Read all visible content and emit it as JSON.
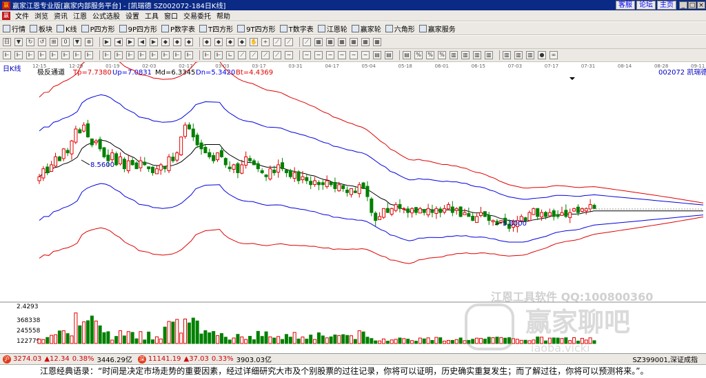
{
  "window": {
    "title": "赢家江恩专业版[赢家内部服务平台] - [凯瑞德  SZ002072-184日K线]",
    "top_links": [
      "客服",
      "论坛",
      "主页"
    ],
    "controls": [
      "_",
      "□",
      "×"
    ]
  },
  "menu": [
    "文件",
    "浏览",
    "资讯",
    "江恩",
    "公式选股",
    "设置",
    "工具",
    "窗口",
    "交易委托",
    "帮助"
  ],
  "toolbar1": [
    "行情",
    "板块",
    "K线",
    "P四方形",
    "9P四方形",
    "P数字表",
    "T四方形",
    "9T四方形",
    "T数字表",
    "江恩轮",
    "赢家轮",
    "六角形",
    "赢家服务"
  ],
  "toolbar2_icons": [
    "日",
    "▼",
    "↻",
    "↺",
    "⊞",
    "0",
    "▼",
    "⊗",
    "▶",
    "◀",
    "▶",
    "◀",
    "▶",
    "◆",
    "◆",
    "◆",
    "◆",
    "◆",
    "◆",
    "◆",
    "✋",
    "+",
    "⟋",
    "⟋",
    "⟋",
    "▦",
    "▦",
    "▦",
    "▦",
    "▦",
    "▦"
  ],
  "toolbar3_icons": [
    "⊩",
    "⊩",
    "⊩",
    "⊩",
    "⊩",
    "⊩",
    "⊩",
    "⊩",
    "⊩",
    "⊩",
    "⊩",
    "⊩",
    "⊩",
    "⊩",
    "⊩",
    "⊩",
    "⊩",
    "⊩",
    "∟",
    "⟋",
    "⟋",
    "⟋",
    "⟋",
    "∼",
    "∼",
    "∼",
    "∼",
    "∼",
    "∼",
    "∼",
    "▤",
    "▤",
    "▤",
    "%",
    "%",
    "%",
    "▥",
    "▥",
    "▥",
    "▥",
    "▥",
    "▥",
    "▥",
    "●",
    "∞"
  ],
  "chart": {
    "period_label": "日K线",
    "indicator": {
      "name": "极反通道",
      "items": [
        {
          "label": "Tp=7.7380",
          "color": "#e00000"
        },
        {
          "label": "Up=7.0831",
          "color": "#0000e0"
        },
        {
          "label": "Md=6.3345",
          "color": "#000000"
        },
        {
          "label": "Dn=5.3420",
          "color": "#0000e0"
        },
        {
          "label": "Bt=4.4369",
          "color": "#e00000"
        }
      ]
    },
    "code_label": "002072  凯瑞德",
    "date_ticks": [
      "12-15",
      "12-29",
      "01-19",
      "02-03",
      "02-17",
      "03-03",
      "03-17",
      "03-31",
      "04-17",
      "05-04",
      "05-18",
      "06-01",
      "06-15",
      "07-03",
      "07-17",
      "07-31",
      "08-14",
      "08-28",
      "09-11"
    ],
    "high_marker": "8.5600",
    "low_marker": "5.8000",
    "volume_ticks": [
      "2.4293",
      "368338",
      "245558",
      "122779"
    ],
    "watermark_title": "江恩工具软件  QQ:100800360",
    "watermark_brand": "赢家聊吧",
    "watermark_url": "iaoba.vicki"
  },
  "colors": {
    "title_bar": "#0b2a86",
    "up_candle": "#e00000",
    "down_candle": "#008000",
    "channel_outer": "#e00000",
    "channel_inner": "#0000e0",
    "channel_mid": "#000000"
  },
  "status": {
    "items": [
      {
        "text": "3274.03",
        "color": "red"
      },
      {
        "text": "▲12.34",
        "color": "red"
      },
      {
        "text": "0.38%",
        "color": "red"
      },
      {
        "text": "3446.29亿",
        "color": "black"
      },
      {
        "text": "11141.19",
        "color": "red"
      },
      {
        "text": "▲37.03",
        "color": "red"
      },
      {
        "text": "0.33%",
        "color": "red"
      },
      {
        "text": "3903.03亿",
        "color": "black"
      }
    ],
    "right_text": "SZ399001,深证成指"
  },
  "quote": "江恩经典语录：“时间是决定市场走势的重要因素，经过详细研究大市及个别股票的过往记录，你将可以证明，历史确实重复发生；而了解过往，你将可以预测将来。”。",
  "chart_data": {
    "type": "candlestick",
    "title": "",
    "x_range": [
      "12-15",
      "09-11"
    ],
    "ylim": [
      4.0,
      9.6
    ],
    "channel": {
      "Tp": 7.738,
      "Up": 7.0831,
      "Md": 6.3345,
      "Dn": 5.342,
      "Bt": 4.4369
    },
    "annotations": [
      {
        "label": "8.5600",
        "type": "high"
      },
      {
        "label": "5.8000",
        "type": "low"
      }
    ],
    "closes": [
      7.1,
      7.3,
      7.2,
      7.4,
      7.6,
      7.5,
      7.8,
      7.7,
      8.0,
      8.3,
      8.2,
      8.4,
      8.1,
      7.9,
      8.0,
      7.8,
      7.6,
      7.5,
      7.7,
      7.4,
      7.6,
      7.3,
      7.5,
      7.4,
      7.3,
      7.5,
      7.4,
      7.3,
      7.2,
      7.3,
      7.4,
      7.3,
      7.6,
      7.5,
      7.7,
      8.1,
      8.4,
      8.3,
      8.1,
      7.9,
      7.8,
      7.7,
      7.6,
      7.5,
      7.7,
      7.6,
      7.4,
      7.3,
      7.4,
      7.2,
      7.4,
      7.6,
      7.5,
      7.4,
      7.3,
      7.2,
      7.1,
      7.3,
      7.2,
      7.4,
      7.3,
      7.2,
      7.1,
      7.2,
      7.0,
      7.1,
      7.0,
      6.9,
      7.0,
      6.9,
      6.9,
      7.0,
      6.9,
      6.8,
      6.9,
      6.8,
      6.7,
      6.8,
      6.7,
      6.9,
      6.8,
      6.6,
      6.2,
      6.0,
      6.1,
      6.3,
      6.2,
      6.3,
      6.4,
      6.3,
      6.3,
      6.2,
      6.3,
      6.2,
      6.3,
      6.2,
      6.3,
      6.2,
      6.3,
      6.2,
      6.3,
      6.4,
      6.2,
      6.3,
      6.1,
      6.2,
      6.1,
      6.0,
      6.1,
      6.2,
      6.1,
      6.0,
      6.0,
      5.9,
      6.0,
      5.9,
      5.8,
      5.9,
      6.0,
      6.1,
      6.0,
      6.2,
      6.3,
      6.1,
      6.2,
      6.1,
      6.2,
      6.1,
      6.1,
      6.2,
      6.1,
      6.2,
      6.3,
      6.2,
      6.3,
      6.3,
      6.4,
      6.3
    ],
    "volume_ylim": [
      0,
      491117
    ]
  }
}
